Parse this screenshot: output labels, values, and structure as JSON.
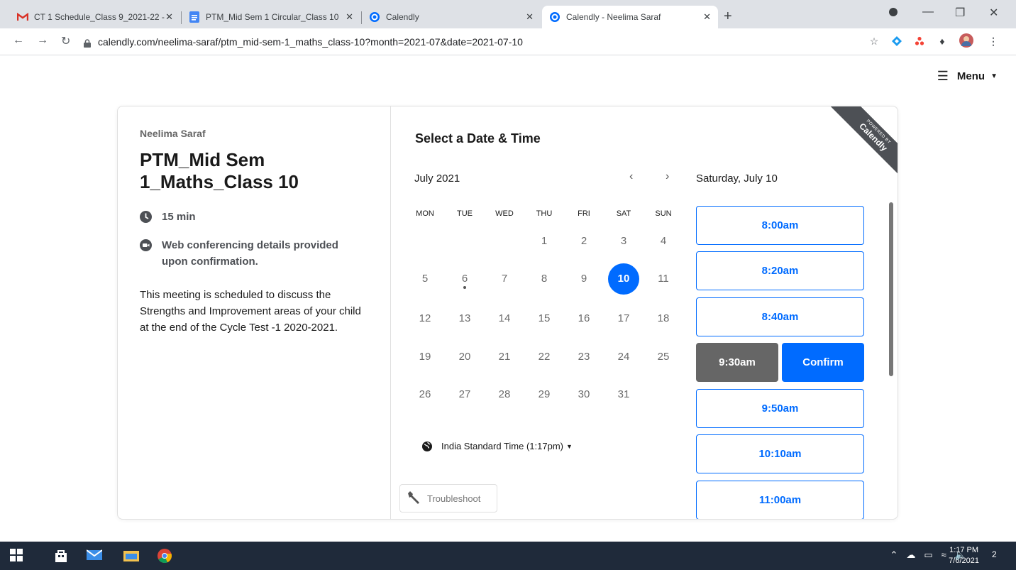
{
  "browser": {
    "tabs": [
      {
        "title": "CT 1 Schedule_Class 9_2021-22 -",
        "icon": "gmail-icon"
      },
      {
        "title": "PTM_Mid Sem 1 Circular_Class 10",
        "icon": "docs-icon"
      },
      {
        "title": "Calendly",
        "icon": "calendly-icon"
      },
      {
        "title": "Calendly - Neelima Saraf",
        "icon": "calendly-icon"
      }
    ],
    "new_tab": "+",
    "url": "calendly.com/neelima-saraf/ptm_mid-sem-1_maths_class-10?month=2021-07&date=2021-07-10"
  },
  "header": {
    "menu_label": "Menu"
  },
  "event": {
    "host": "Neelima Saraf",
    "title": "PTM_Mid Sem 1_Maths_Class 10",
    "duration": "15 min",
    "conferencing": "Web conferencing details provided upon confirmation.",
    "description": "This meeting is scheduled to discuss the Strengths and Improvement areas of your child at the end of the Cycle Test -1 2020-2021."
  },
  "calendar": {
    "heading": "Select a Date & Time",
    "month": "July 2021",
    "weekdays": [
      "MON",
      "TUE",
      "WED",
      "THU",
      "FRI",
      "SAT",
      "SUN"
    ],
    "selected_day": "10",
    "timezone": "India Standard Time (1:17pm)",
    "troubleshoot": "Troubleshoot"
  },
  "times": {
    "date_heading": "Saturday, July 10",
    "slots": [
      "8:00am",
      "8:20am",
      "8:40am",
      "9:30am",
      "9:50am",
      "10:10am",
      "11:00am"
    ],
    "selected": "9:30am",
    "confirm_label": "Confirm"
  },
  "ribbon": {
    "line1": "POWERED BY",
    "line2": "Calendly"
  },
  "taskbar": {
    "time": "1:17 PM",
    "date": "7/6/2021",
    "notifications": "2"
  },
  "colors": {
    "accent": "#006bff",
    "selected_slot": "#666666",
    "ribbon": "#4d5055",
    "taskbar": "#1f2a3a"
  }
}
